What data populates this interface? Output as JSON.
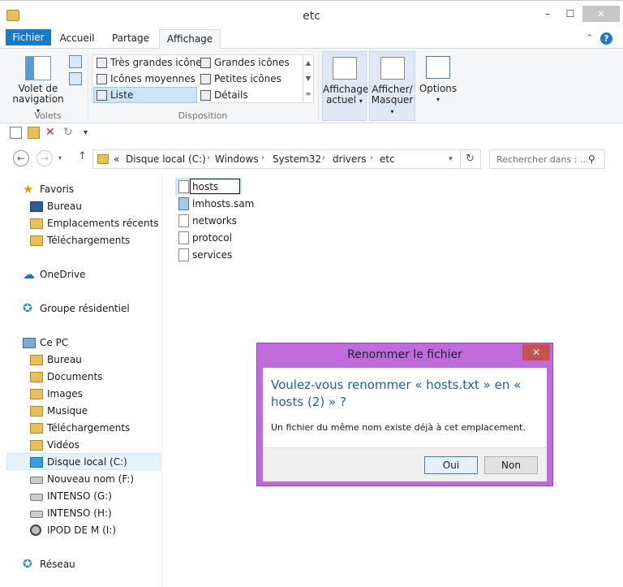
{
  "window": {
    "title": "etc",
    "min": "–",
    "max": "☐",
    "close": "✕"
  },
  "tabs": {
    "file": "Fichier",
    "home": "Accueil",
    "share": "Partage",
    "view": "Affichage"
  },
  "ribbon": {
    "nav_pane_label": "Volet de\nnavigation ▾",
    "nav_pane_line1": "Volet de",
    "nav_pane_line2": "navigation",
    "group_panes": "Volets",
    "group_layout": "Disposition",
    "layout": {
      "very_large": "Très grandes icônes",
      "large": "Grandes icônes",
      "medium": "Icônes moyennes",
      "small": "Petites icônes",
      "list": "Liste",
      "details": "Détails"
    },
    "current_view_line1": "Affichage",
    "current_view_line2": "actuel",
    "show_hide_line1": "Afficher/",
    "show_hide_line2": "Masquer",
    "options": "Options"
  },
  "address": {
    "prefix": "«",
    "crumbs": [
      "Disque local (C:)",
      "Windows",
      "System32",
      "drivers",
      "etc"
    ],
    "search_placeholder": "Rechercher dans : ..."
  },
  "nav": {
    "favorites": "Favoris",
    "desktop": "Bureau",
    "recent": "Emplacements récents",
    "downloads": "Téléchargements",
    "onedrive": "OneDrive",
    "homegroup": "Groupe résidentiel",
    "this_pc": "Ce PC",
    "pc_desktop": "Bureau",
    "documents": "Documents",
    "images": "Images",
    "music": "Musique",
    "pc_downloads": "Téléchargements",
    "videos": "Vidéos",
    "local_disk": "Disque local (C:)",
    "new_name": "Nouveau nom (F:)",
    "intenso_g": "INTENSO (G:)",
    "intenso_h": "INTENSO (H:)",
    "ipod": "IPOD DE M (I:)",
    "network": "Réseau"
  },
  "files": {
    "rename_value": "hosts",
    "lmhosts": "lmhosts.sam",
    "networks": "networks",
    "protocol": "protocol",
    "services": "services"
  },
  "dialog": {
    "title": "Renommer le fichier",
    "question": "Voulez-vous renommer « hosts.txt » en « hosts (2) » ?",
    "info": "Un fichier du même nom existe déjà à cet emplacement.",
    "yes": "Oui",
    "no": "Non",
    "close": "✕"
  }
}
